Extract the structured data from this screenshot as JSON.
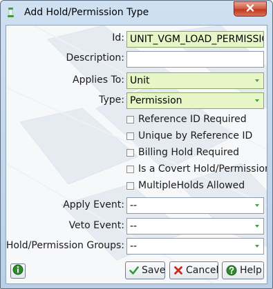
{
  "window": {
    "title": "Add Hold/Permission Type"
  },
  "form": {
    "id": {
      "label": "Id:",
      "value": "UNIT_VGM_LOAD_PERMISSIO"
    },
    "description": {
      "label": "Description:",
      "value": ""
    },
    "applies_to": {
      "label": "Applies To:",
      "value": "Unit"
    },
    "type": {
      "label": "Type:",
      "value": "Permission"
    },
    "checkboxes": [
      {
        "label": "Reference ID Required",
        "checked": false
      },
      {
        "label": "Unique by Reference ID",
        "checked": false
      },
      {
        "label": "Billing Hold Required",
        "checked": false
      },
      {
        "label": "Is a Covert Hold/Permission",
        "checked": false
      },
      {
        "label": "MultipleHolds Allowed",
        "checked": false
      }
    ],
    "apply_event": {
      "label": "Apply Event:",
      "value": "--"
    },
    "veto_event": {
      "label": "Veto Event:",
      "value": "--"
    },
    "groups": {
      "label": "Hold/Permission Groups:",
      "value": "--"
    }
  },
  "buttons": {
    "save": "Save",
    "cancel": "Cancel",
    "help": "Help"
  },
  "colors": {
    "required_field_bg": "#e6f6c6",
    "accent_green": "#46a03a",
    "close_red": "#c2381e"
  },
  "icons": {
    "app": "lamp-icon",
    "close": "close-icon",
    "info": "info-icon",
    "save": "checkmark-icon",
    "cancel": "x-icon",
    "help": "question-icon"
  }
}
